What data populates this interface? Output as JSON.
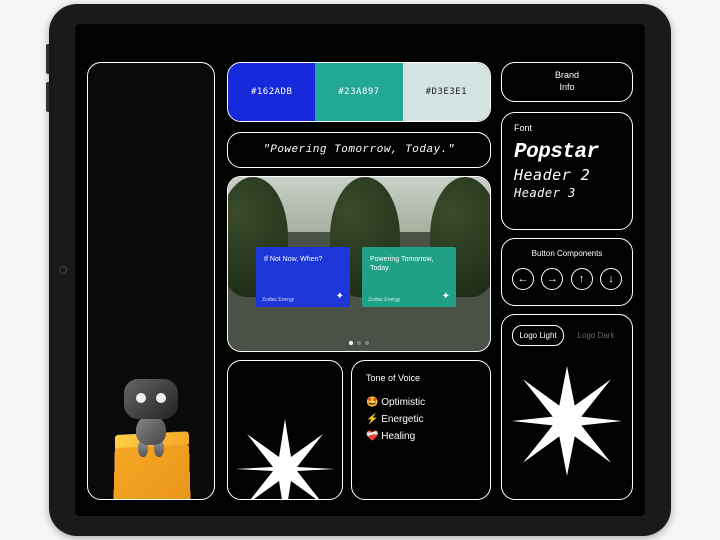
{
  "palette": [
    {
      "hex": "#162ADB",
      "fg": "#ffffff"
    },
    {
      "hex": "#23A897",
      "fg": "#ffffff"
    },
    {
      "hex": "#D3E3E1",
      "fg": "#222222"
    }
  ],
  "tagline": "\"Powering Tomorrow, Today.\"",
  "mockup": {
    "billboard1": {
      "headline": "If Not Now, When?",
      "brand": "Zodiac Energy"
    },
    "billboard2": {
      "headline": "Powering Tomorrow, Today.",
      "brand": "Zodiac Energy"
    }
  },
  "brand_info": {
    "label": "Brand\nInfo"
  },
  "font": {
    "label": "Font",
    "h1": "Popstar",
    "h2": "Header 2",
    "h3": "Header 3"
  },
  "buttons": {
    "label": "Button Components",
    "icons": [
      "arrow-left",
      "arrow-right",
      "arrow-up",
      "arrow-down"
    ]
  },
  "tone": {
    "label": "Tone of Voice",
    "items": [
      {
        "emoji": "🤩",
        "text": "Optimistic"
      },
      {
        "emoji": "⚡",
        "text": "Energetic"
      },
      {
        "emoji": "❤️‍🩹",
        "text": "Healing"
      }
    ]
  },
  "logo": {
    "tabs": [
      "Logo Light",
      "Logo Dark"
    ],
    "active": 0
  }
}
